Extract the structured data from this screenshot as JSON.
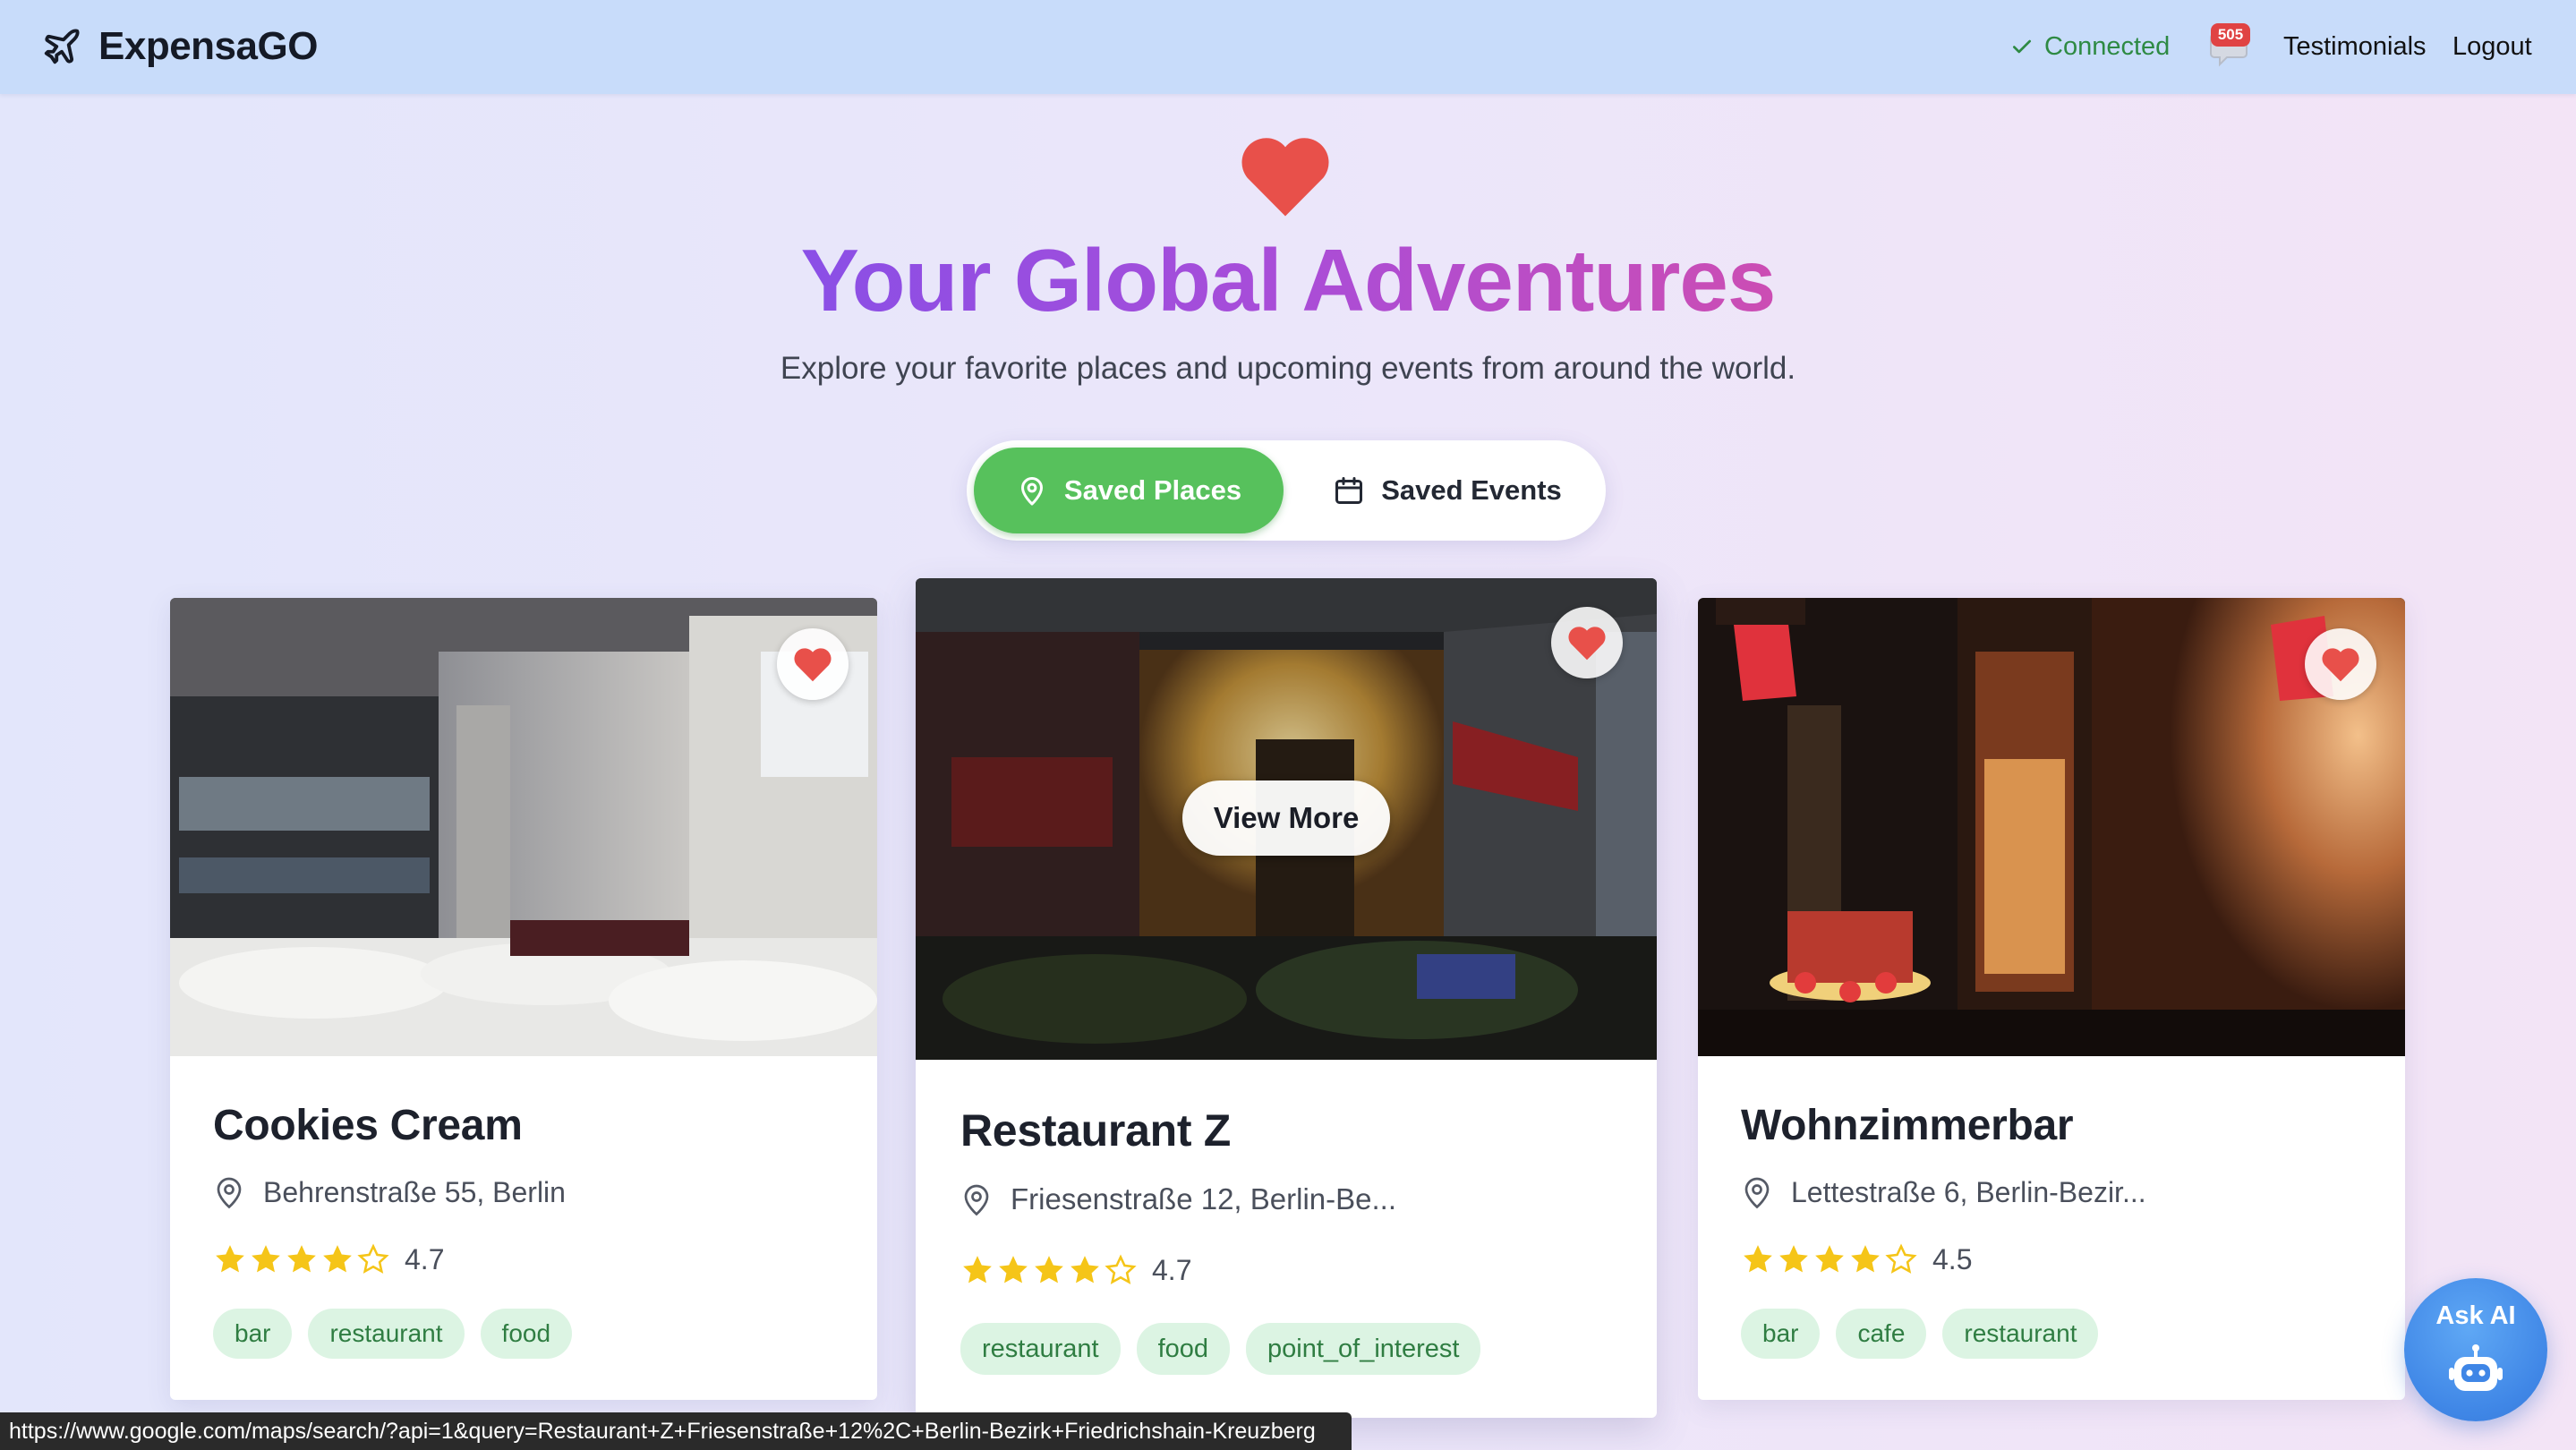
{
  "header": {
    "brand": "ExpensaGO",
    "brand_icon": "plane-icon",
    "status": "Connected",
    "status_icon": "check-icon",
    "notification_count": "505",
    "notification_icon": "message-bell-icon",
    "links": {
      "testimonials": "Testimonials",
      "logout": "Logout"
    }
  },
  "hero": {
    "icon": "heart-icon",
    "title": "Your Global Adventures",
    "subtitle": "Explore your favorite places and upcoming events from around the world."
  },
  "toggle": {
    "saved_places": "Saved Places",
    "saved_events": "Saved Events",
    "active": "saved_places"
  },
  "cards": [
    {
      "name": "Cookies Cream",
      "address": "Behrenstraße 55, Berlin",
      "rating": "4.7",
      "stars": 4,
      "tags": [
        "bar",
        "restaurant",
        "food"
      ],
      "favorited": true
    },
    {
      "name": "Restaurant Z",
      "address": "Friesenstraße 12, Berlin-Be...",
      "rating": "4.7",
      "stars": 4,
      "tags": [
        "restaurant",
        "food",
        "point_of_interest"
      ],
      "favorited": true,
      "hover_action": "View More"
    },
    {
      "name": "Wohnzimmerbar",
      "address": "Lettestraße 6, Berlin-Bezir...",
      "rating": "4.5",
      "stars": 4,
      "tags": [
        "bar",
        "cafe",
        "restaurant"
      ],
      "favorited": true
    }
  ],
  "ask_ai": {
    "label": "Ask AI",
    "icon": "robot-icon"
  },
  "status_bar_url": "https://www.google.com/maps/search/?api=1&query=Restaurant+Z+Friesenstraße+12%2C+Berlin-Bezirk+Friedrichshain-Kreuzberg",
  "colors": {
    "header_bg": "#c8dcfa",
    "accent_green": "#57c15c",
    "heart_red": "#e8504a",
    "tag_bg": "#dcf4e3",
    "tag_text": "#2f7d42",
    "star_yellow": "#f5c518",
    "ai_blue": "#3f86e6"
  }
}
